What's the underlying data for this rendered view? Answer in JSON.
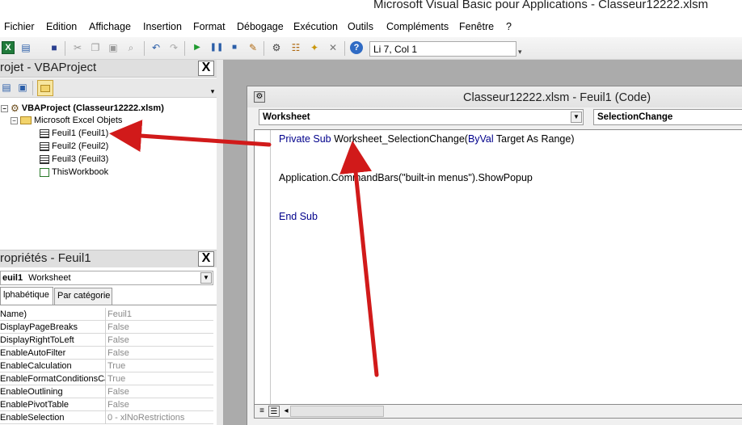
{
  "window": {
    "title": "Microsoft Visual Basic pour Applications - Classeur12222.xlsm"
  },
  "menu": [
    {
      "label": "Fichier"
    },
    {
      "label": "Edition"
    },
    {
      "label": "Affichage"
    },
    {
      "label": "Insertion"
    },
    {
      "label": "Format"
    },
    {
      "label": "Débogage"
    },
    {
      "label": "Exécution"
    },
    {
      "label": "Outils"
    },
    {
      "label": "Compléments"
    },
    {
      "label": "Fenêtre"
    },
    {
      "label": "?"
    }
  ],
  "toolbar": {
    "position": "Li 7, Col 1",
    "icons": [
      "excel-icon",
      "insert-module-icon",
      "save-icon",
      "cut-icon",
      "copy-icon",
      "paste-icon",
      "find-icon",
      "undo-icon",
      "redo-icon",
      "run-icon",
      "break-icon",
      "reset-icon",
      "design-mode-icon",
      "project-explorer-icon",
      "properties-icon",
      "object-browser-icon",
      "toolbox-icon",
      "help-icon"
    ]
  },
  "project": {
    "title": "rojet - VBAProject",
    "close": "X",
    "root": "VBAProject (Classeur12222.xlsm)",
    "folder": "Microsoft Excel Objets",
    "items": [
      {
        "label": "Feuil1 (Feuil1)"
      },
      {
        "label": "Feuil2 (Feuil2)"
      },
      {
        "label": "Feuil3 (Feuil3)"
      },
      {
        "label": "ThisWorkbook"
      }
    ]
  },
  "properties": {
    "title": "ropriétés - Feuil1",
    "close": "X",
    "object_name": "euil1",
    "object_type": "Worksheet",
    "tabs": [
      "lphabétique",
      "Par catégorie"
    ],
    "rows": [
      {
        "name": "Name)",
        "value": "Feuil1"
      },
      {
        "name": "DisplayPageBreaks",
        "value": "False"
      },
      {
        "name": "DisplayRightToLeft",
        "value": "False"
      },
      {
        "name": "EnableAutoFilter",
        "value": "False"
      },
      {
        "name": "EnableCalculation",
        "value": "True"
      },
      {
        "name": "EnableFormatConditionsCalc",
        "value": "True"
      },
      {
        "name": "EnableOutlining",
        "value": "False"
      },
      {
        "name": "EnablePivotTable",
        "value": "False"
      },
      {
        "name": "EnableSelection",
        "value": "0 - xlNoRestrictions"
      }
    ]
  },
  "code_window": {
    "title": "Classeur12222.xlsm - Feuil1 (Code)",
    "object_combo": "Worksheet",
    "proc_combo": "SelectionChange",
    "lines": {
      "line1_kw1": "Private Sub ",
      "line1_name": "Worksheet_SelectionChange(",
      "line1_kw2": "ByVal",
      "line1_rest": " Target As Range)",
      "line2": "Application.CommandBars(\"built-in menus\").ShowPopup",
      "line3": "End Sub"
    }
  },
  "colors": {
    "arrow": "#d11a1a",
    "keyword": "#00008b",
    "workspace": "#ababab"
  }
}
